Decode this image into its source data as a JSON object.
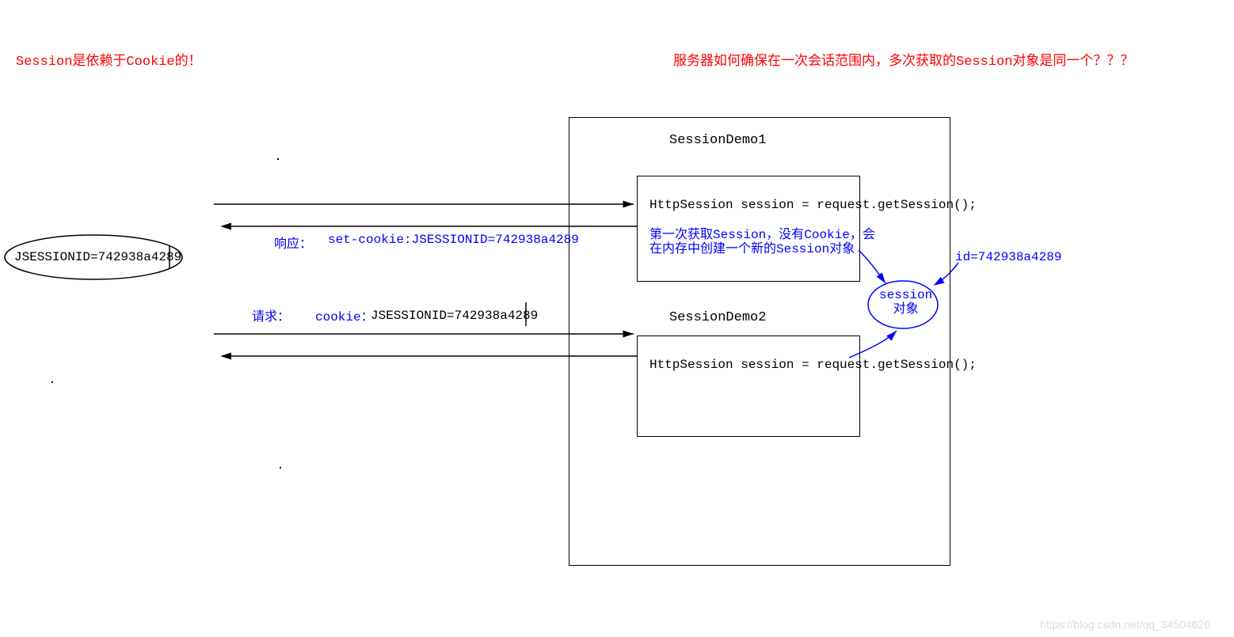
{
  "title_left": "Session是依赖于Cookie的！",
  "title_right": "服务器如何确保在一次会话范围内，多次获取的Session对象是同一个？？？",
  "client_cookie": "JSESSIONID=742938a4289",
  "response_label": "响应：",
  "response_value": "set-cookie:JSESSIONID=742938a4289",
  "request_label": "请求：",
  "request_cookie_label": "cookie：",
  "request_cookie_value": "JSESSIONID=742938a4289",
  "server_box1_title": "SessionDemo1",
  "server_box1_code": "HttpSession session = request.getSession();",
  "server_box1_note1": "第一次获取Session，没有Cookie，会",
  "server_box1_note2": "在内存中创建一个新的Session对象",
  "server_box2_title": "SessionDemo2",
  "server_box2_code": "HttpSession session = request.getSession();",
  "session_obj_line1": "session",
  "session_obj_line2": "对象",
  "session_id_label": "id=742938a4289",
  "watermark": "https://blog.csdn.net/qq_34504626"
}
